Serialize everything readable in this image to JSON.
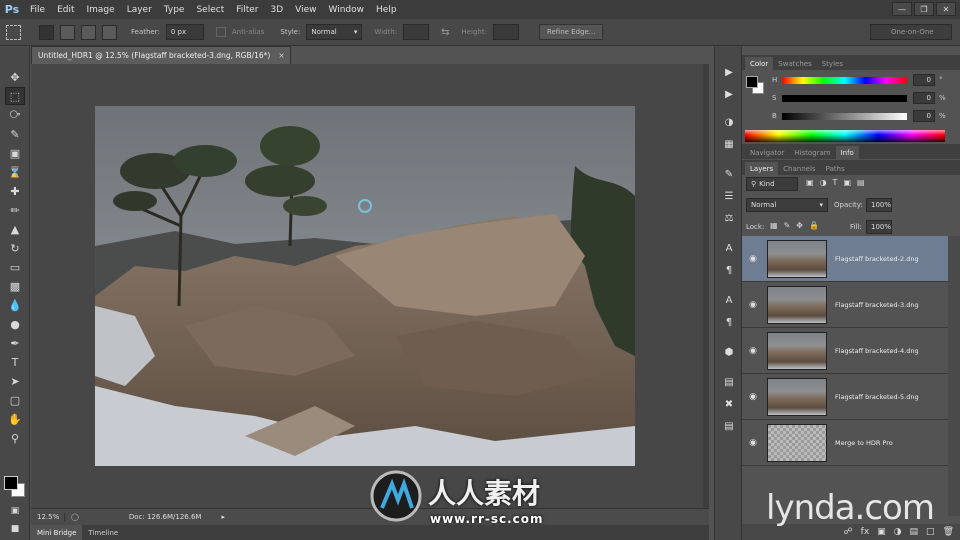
{
  "app": {
    "logo": "Ps"
  },
  "menu": [
    "File",
    "Edit",
    "Image",
    "Layer",
    "Type",
    "Select",
    "Filter",
    "3D",
    "View",
    "Window",
    "Help"
  ],
  "options": {
    "feather_label": "Feather:",
    "feather_value": "0 px",
    "antialias_label": "Anti-alias",
    "style_label": "Style:",
    "style_value": "Normal",
    "width_label": "Width:",
    "height_label": "Height:",
    "refine_edge": "Refine Edge...",
    "workspace": "One-on-One"
  },
  "document": {
    "tab_title": "Untitled_HDR1 @ 12.5% (Flagstaff bracketed-3.dng, RGB/16*)",
    "close_glyph": "×",
    "zoom": "12.5%",
    "doc_info": "Doc: 126.6M/126.6M"
  },
  "bottom_tabs": [
    "Mini Bridge",
    "Timeline"
  ],
  "color_panel": {
    "tabs": [
      "Color",
      "Swatches",
      "Styles"
    ],
    "sliders": [
      {
        "letter": "H",
        "value": "0",
        "unit": "°"
      },
      {
        "letter": "S",
        "value": "0",
        "unit": "%"
      },
      {
        "letter": "B",
        "value": "0",
        "unit": "%"
      }
    ]
  },
  "info_panel": {
    "tabs": [
      "Navigator",
      "Histogram",
      "Info"
    ]
  },
  "layers_panel": {
    "tabs": [
      "Layers",
      "Channels",
      "Paths"
    ],
    "kind": "Kind",
    "blend_mode": "Normal",
    "opacity_label": "Opacity:",
    "opacity_value": "100%",
    "lock_label": "Lock:",
    "fill_label": "Fill:",
    "fill_value": "100%",
    "layers": [
      {
        "name": "Flagstaff bracketed-2.dng",
        "selected": true,
        "thumb": "photo"
      },
      {
        "name": "Flagstaff bracketed-3.dng",
        "selected": false,
        "thumb": "photo"
      },
      {
        "name": "Flagstaff bracketed-4.dng",
        "selected": false,
        "thumb": "photo"
      },
      {
        "name": "Flagstaff bracketed-5.dng",
        "selected": false,
        "thumb": "photo"
      },
      {
        "name": "Merge to HDR Pro",
        "selected": false,
        "thumb": "transparent"
      }
    ]
  },
  "watermark": {
    "text": "人人素材",
    "url": "www.rr-sc.com",
    "brand": "lynda.com"
  },
  "colors": {
    "selection": "#6e7d92",
    "panel": "#535353",
    "menubar": "#3c3c3c"
  }
}
